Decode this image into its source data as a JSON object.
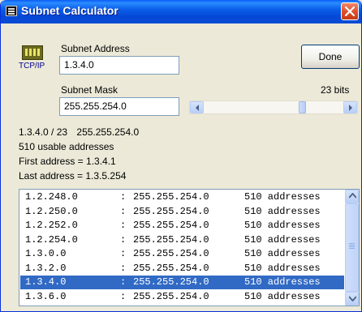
{
  "window": {
    "title": "Subnet Calculator",
    "title_icon": "calculator-icon",
    "close_icon": "close-icon"
  },
  "app_icon": {
    "name": "network-card-icon",
    "label": "TCP/IP"
  },
  "subnet_address": {
    "label": "Subnet Address",
    "value": "1.3.4.0"
  },
  "subnet_mask": {
    "label": "Subnet Mask",
    "value": "255.255.254.0"
  },
  "done_button": {
    "label": "Done"
  },
  "bits": {
    "label": "23 bits",
    "slider_value": 23,
    "slider_min": 0,
    "slider_max": 32
  },
  "info": {
    "cidr": "1.3.4.0 / 23",
    "mask": "255.255.254.0",
    "usable": "510 usable addresses",
    "first": "First address = 1.3.4.1",
    "last": "Last address = 1.3.5.254"
  },
  "subnets": [
    {
      "network": "1.2.248.0",
      "sep": ":",
      "mask": "255.255.254.0",
      "addresses": "510 addresses"
    },
    {
      "network": "1.2.250.0",
      "sep": ":",
      "mask": "255.255.254.0",
      "addresses": "510 addresses"
    },
    {
      "network": "1.2.252.0",
      "sep": ":",
      "mask": "255.255.254.0",
      "addresses": "510 addresses"
    },
    {
      "network": "1.2.254.0",
      "sep": ":",
      "mask": "255.255.254.0",
      "addresses": "510 addresses"
    },
    {
      "network": "1.3.0.0",
      "sep": ":",
      "mask": "255.255.254.0",
      "addresses": "510 addresses"
    },
    {
      "network": "1.3.2.0",
      "sep": ":",
      "mask": "255.255.254.0",
      "addresses": "510 addresses"
    },
    {
      "network": "1.3.4.0",
      "sep": ":",
      "mask": "255.255.254.0",
      "addresses": "510 addresses"
    },
    {
      "network": "1.3.6.0",
      "sep": ":",
      "mask": "255.255.254.0",
      "addresses": "510 addresses"
    }
  ],
  "selected_row": 6,
  "colors": {
    "titlebar": "#0a5ee8",
    "selection": "#316ac5",
    "close": "#e2502c"
  }
}
